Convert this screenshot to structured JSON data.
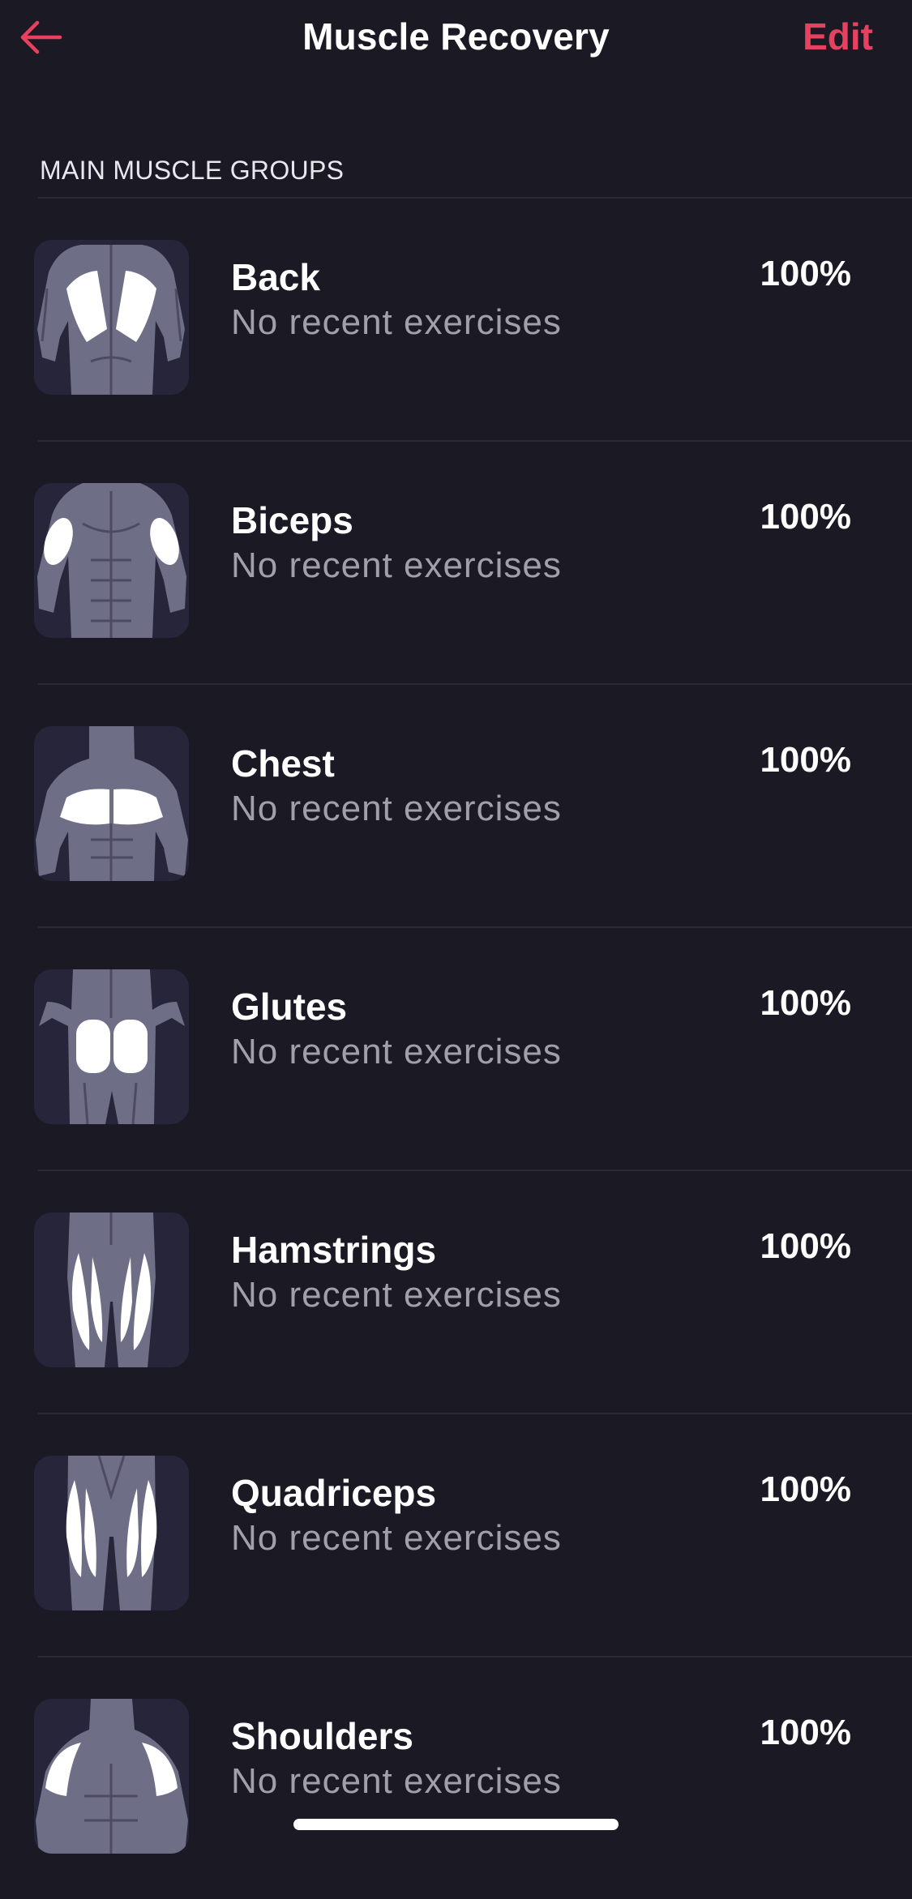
{
  "header": {
    "title": "Muscle Recovery",
    "edit_label": "Edit",
    "back_icon": "arrow-left-icon",
    "accent_color": "#e8405f"
  },
  "section": {
    "title": "MAIN MUSCLE GROUPS"
  },
  "muscles": [
    {
      "name": "Back",
      "status": "No recent exercises",
      "recovery": "100%",
      "icon": "back-muscle-icon"
    },
    {
      "name": "Biceps",
      "status": "No recent exercises",
      "recovery": "100%",
      "icon": "biceps-muscle-icon"
    },
    {
      "name": "Chest",
      "status": "No recent exercises",
      "recovery": "100%",
      "icon": "chest-muscle-icon"
    },
    {
      "name": "Glutes",
      "status": "No recent exercises",
      "recovery": "100%",
      "icon": "glutes-muscle-icon"
    },
    {
      "name": "Hamstrings",
      "status": "No recent exercises",
      "recovery": "100%",
      "icon": "hamstrings-muscle-icon"
    },
    {
      "name": "Quadriceps",
      "status": "No recent exercises",
      "recovery": "100%",
      "icon": "quadriceps-muscle-icon"
    },
    {
      "name": "Shoulders",
      "status": "No recent exercises",
      "recovery": "100%",
      "icon": "shoulders-muscle-icon"
    }
  ]
}
